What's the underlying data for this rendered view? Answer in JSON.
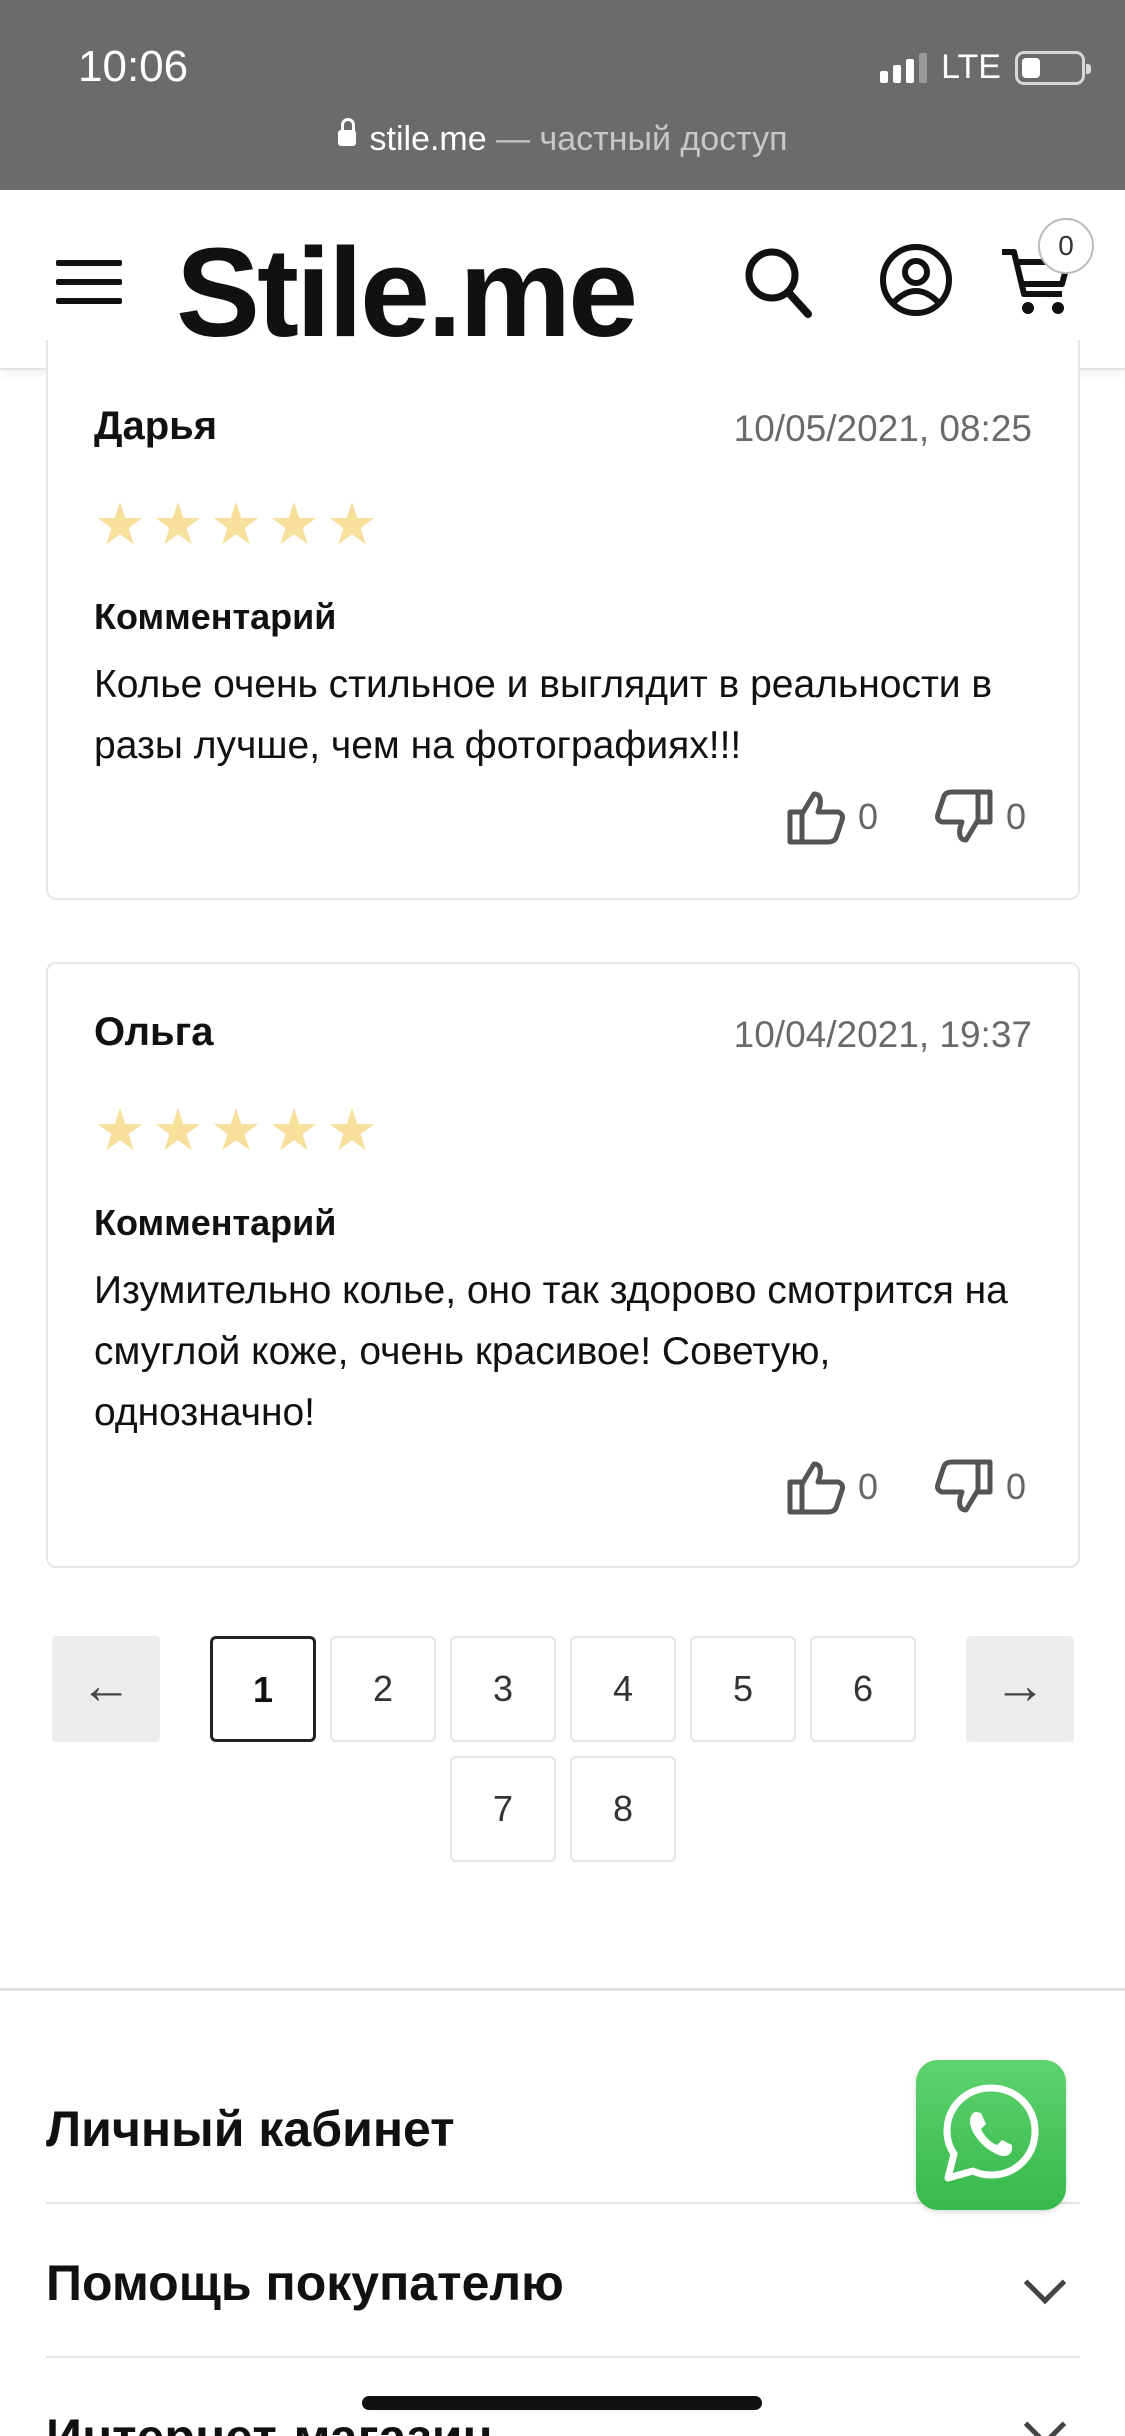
{
  "status_bar": {
    "time": "10:06",
    "network": "LTE",
    "url": "stile.me",
    "url_suffix": " — частный доступ",
    "signal_bars_on": 3,
    "signal_bars_total": 4,
    "battery_level": 0.3
  },
  "header": {
    "logo": "Stile.me",
    "cart_count": "0",
    "icons": [
      "menu-icon",
      "search-icon",
      "user-icon",
      "cart-icon"
    ]
  },
  "reviews": [
    {
      "name": "Дарья",
      "date": "10/05/2021, 08:25",
      "rating": 5,
      "comment_label": "Комментарий",
      "text": "Колье очень стильное и выглядит в реальности в разы лучше, чем на фотографиях!!!",
      "likes": "0",
      "dislikes": "0"
    },
    {
      "name": "Ольга",
      "date": "10/04/2021, 19:37",
      "rating": 5,
      "comment_label": "Комментарий",
      "text": "Изумительно колье, оно так здорово смотрится на смуглой коже, очень красивое! Советую, однозначно!",
      "likes": "0",
      "dislikes": "0"
    }
  ],
  "pagination": {
    "prev": "←",
    "next": "→",
    "pages": [
      "1",
      "2",
      "3",
      "4",
      "5",
      "6",
      "7",
      "8"
    ],
    "current": "1"
  },
  "footer": {
    "sections": [
      "Личный кабинет",
      "Помощь покупателю",
      "Интернет-магазин"
    ]
  },
  "colors": {
    "status_bar": "#6b6b6b",
    "star": "#f7df9c",
    "whatsapp": "#41c452"
  }
}
